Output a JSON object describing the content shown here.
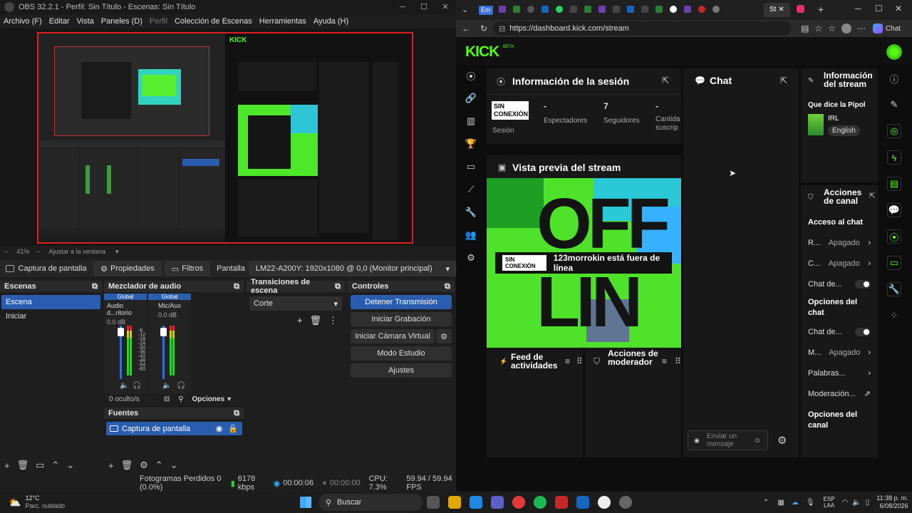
{
  "obs": {
    "title": "OBS 32.2.1 - Perfil: Sin Título - Escenas: Sin Título",
    "menu": [
      "Archivo (F)",
      "Editar",
      "Vista",
      "Paneles (D)",
      "Perfil",
      "Colección de Escenas",
      "Herramientas",
      "Ayuda (H)"
    ],
    "zoom": "41%",
    "zoom_mode": "Ajustar a la ventana",
    "source_name": "Captura de pantalla",
    "properties": "Propiedades",
    "filters": "Filtros",
    "screen_label": "Pantalla",
    "screen_value": "LM22-A200Y: 1920x1080 @ 0,0 (Monitor principal)",
    "scenes": {
      "title": "Escenas",
      "items": [
        "Escena",
        "Iniciar"
      ]
    },
    "mixer": {
      "title": "Mezclador de audio",
      "channels": [
        {
          "global": "Global",
          "name": "Audio d...ritorio",
          "db": "0.0 dB"
        },
        {
          "global": "Global",
          "name": "Mic/Aux",
          "db": "0.0 dB"
        }
      ],
      "scale": [
        "-6",
        "-12",
        "-18",
        "-24",
        "-30",
        "-36",
        "-42",
        "-48",
        "-54",
        "-60"
      ],
      "hidden": "0 oculto/s",
      "options": "Opciones"
    },
    "transitions": {
      "title": "Transiciones de escena",
      "value": "Corte"
    },
    "controls": {
      "title": "Controles",
      "stop": "Detener Transmisión",
      "record": "Iniciar Grabación",
      "vcam": "Iniciar Cámara Virtual",
      "studio": "Modo Estudio",
      "settings": "Ajustes"
    },
    "sources": {
      "title": "Fuentes",
      "items": [
        "Captura de pantalla"
      ]
    },
    "status": {
      "dropped": "Fotogramas Perdidos 0 (0.0%)",
      "kbps": "6178 kbps",
      "time1": "00:00:06",
      "time2": "00:00:00",
      "cpu": "CPU: 7.3%",
      "fps": "59.94 / 59.94 FPS"
    }
  },
  "browser": {
    "url": "https://dashboard.kick.com/stream",
    "chat_label": "Chat",
    "tab_labels": [
      "Em",
      "St"
    ]
  },
  "kick": {
    "logo": "KICK",
    "beta": "BETA",
    "session": {
      "title": "Información de la sesión",
      "badge": "SIN CONEXIÓN",
      "badge_label": "Sesión",
      "viewers_value": "-",
      "viewers_label": "Espectadores",
      "followers_value": "7",
      "followers_label": "Seguidores",
      "subs_value": "-",
      "subs_label": "Cantida suscrip"
    },
    "preview": {
      "title": "Vista previa del stream",
      "offline_badge": "SIN CONEXIÓN",
      "offline_text": "123morrokin está fuera de línea",
      "big_text_1": "OFF",
      "big_text_2": "LIN"
    },
    "feed": {
      "title": "Feed de actividades"
    },
    "mod": {
      "title": "Acciones de moderador"
    },
    "chat": {
      "title": "Chat",
      "placeholder": "Enviar un mensaje"
    },
    "stream_info": {
      "title": "Información del stream",
      "stream_title": "Que dice la Pipol",
      "category": "IRL",
      "language": "English"
    },
    "channel_actions": {
      "title": "Acciones de canal",
      "access_title": "Acceso al chat",
      "rows1": [
        {
          "label": "R...",
          "value": "Apagado"
        },
        {
          "label": "C...",
          "value": "Apagado"
        }
      ],
      "chat_de": "Chat de...",
      "options_title": "Opciones del chat",
      "chat_de2": "Chat de...",
      "m_label": "M...",
      "m_value": "Apagado",
      "words": "Palabras...",
      "moderation": "Moderación...",
      "channel_options": "Opciones del canal"
    }
  },
  "taskbar": {
    "temp": "12°C",
    "weather": "Parc. nublado",
    "search": "Buscar",
    "lang1": "ESP",
    "lang2": "LAA",
    "time": "11:38 p. m.",
    "date": "6/08/2026"
  },
  "colors": {
    "kick_green": "#53fc18",
    "obs_blue": "#2a5db0",
    "stream_red": "#e02020"
  }
}
